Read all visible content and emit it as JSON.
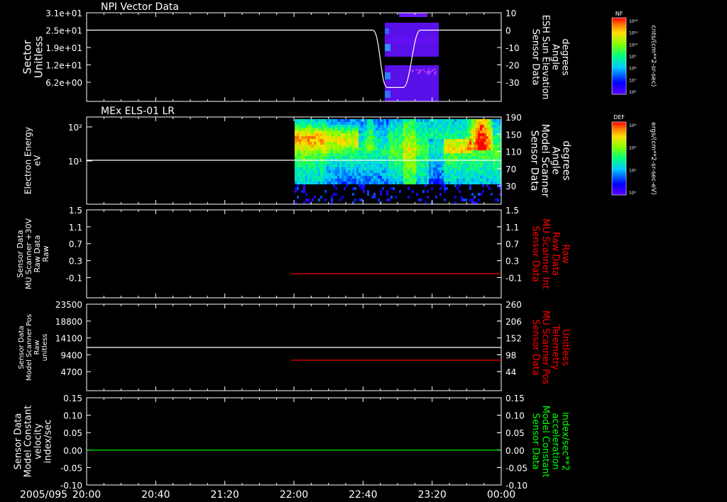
{
  "date_label": "2005/095",
  "x_ticks": [
    "20:00",
    "20:40",
    "21:20",
    "22:00",
    "22:40",
    "23:20",
    "00:00"
  ],
  "colors": {
    "white": "#ffffff",
    "red": "#ff0000",
    "green": "#00ff00"
  },
  "chart_data": [
    {
      "type": "heatmap",
      "title": "NPI Vector Data",
      "ylabel": "Sector\nUnitless",
      "y_ticks": [
        "3.1e+01",
        "2.5e+01",
        "1.9e+01",
        "1.2e+01",
        "6.2e+00"
      ],
      "y2label": "Sensor Data\nESH Sun Elevation\nAngle\ndegrees",
      "y2_ticks": [
        "10",
        "0",
        "-10",
        "-20",
        "-30"
      ],
      "y2lim": [
        -40,
        10
      ],
      "colorbar": {
        "label": "NF",
        "units": "cnts/(cm**2-sr-sec)",
        "ticks": [
          "10¹²",
          "10¹¹",
          "10¹⁰",
          "10⁹",
          "10⁸",
          "10⁷",
          "10⁶"
        ]
      },
      "line_series": {
        "name": "",
        "color": "#ffffff",
        "points": [
          [
            0,
            0
          ],
          [
            0.62,
            0
          ],
          [
            0.66,
            -33
          ],
          [
            0.71,
            -33
          ],
          [
            0.74,
            0
          ],
          [
            1,
            0
          ]
        ]
      }
    },
    {
      "type": "heatmap",
      "title": "MEx ELS-01 LR",
      "ylabel": "Electron Energy\neV",
      "y_ticks": [
        "10²",
        "10¹"
      ],
      "y2label": "Sensor Data\nModel Scanner\nAngle\ndegrees",
      "y2_ticks": [
        "190",
        "150",
        "110",
        "70",
        "30"
      ],
      "y2lim": [
        0,
        190
      ],
      "colorbar": {
        "label": "DEF",
        "units": "ergs/(cm**2-sr-sec-eV)",
        "ticks": [
          "10⁴",
          "10³",
          "10²",
          "10¹"
        ]
      },
      "line_series": {
        "name": "",
        "color": "#ffffff",
        "points": [
          [
            0,
            85
          ],
          [
            1,
            85
          ]
        ]
      }
    },
    {
      "type": "line",
      "ylabel": "Sensor Data\nMU Scanner +30V\nRaw Data\nRaw",
      "y_ticks": [
        "1.5",
        "1.1",
        "0.7",
        "0.3",
        "-0.1"
      ],
      "ylim": [
        -0.3,
        1.5
      ],
      "y2label": "Sensor Data\nMU Scanner Int\nRaw Data\nRaw",
      "y2_ticks": [
        "1.5",
        "1.1",
        "0.7",
        "0.3",
        "-0.1"
      ],
      "series": [
        {
          "name": "",
          "color": "#ff0000",
          "points": [
            [
              0.43,
              0
            ],
            [
              1,
              0
            ]
          ]
        }
      ]
    },
    {
      "type": "line",
      "ylabel": "Sensor Data\nModel Scanner Pos\nRaw\nunitless",
      "y_ticks": [
        "23500",
        "18800",
        "14100",
        "9400",
        "4700"
      ],
      "ylim": [
        0,
        23500
      ],
      "y2label": "Sensor Data\nMU Scanner Pos\nTelemetry\nUnitless",
      "y2_ticks": [
        "260",
        "206",
        "152",
        "98",
        "44"
      ],
      "series": [
        {
          "name": "",
          "color": "#ffffff",
          "points": [
            [
              0,
              11700
            ],
            [
              1,
              11700
            ]
          ]
        },
        {
          "name": "",
          "color": "#ff0000",
          "points": [
            [
              0.43,
              8300
            ],
            [
              1,
              8300
            ]
          ]
        }
      ]
    },
    {
      "type": "line",
      "ylabel": "Sensor Data\nModel Constant\nvelocity\nindex/sec",
      "y_ticks": [
        "0.15",
        "0.10",
        "0.05",
        "0.00",
        "-0.05",
        "-0.10"
      ],
      "ylim": [
        -0.1,
        0.15
      ],
      "y2label": "Sensor Data\nModel Constant\nacceleration\nindex/sec**2",
      "y2_ticks": [
        "0.15",
        "0.10",
        "0.05",
        "0.00",
        "-0.05",
        "-0.10"
      ],
      "series": [
        {
          "name": "",
          "color": "#00ff00",
          "points": [
            [
              0,
              0
            ],
            [
              1,
              0
            ]
          ]
        }
      ]
    }
  ]
}
